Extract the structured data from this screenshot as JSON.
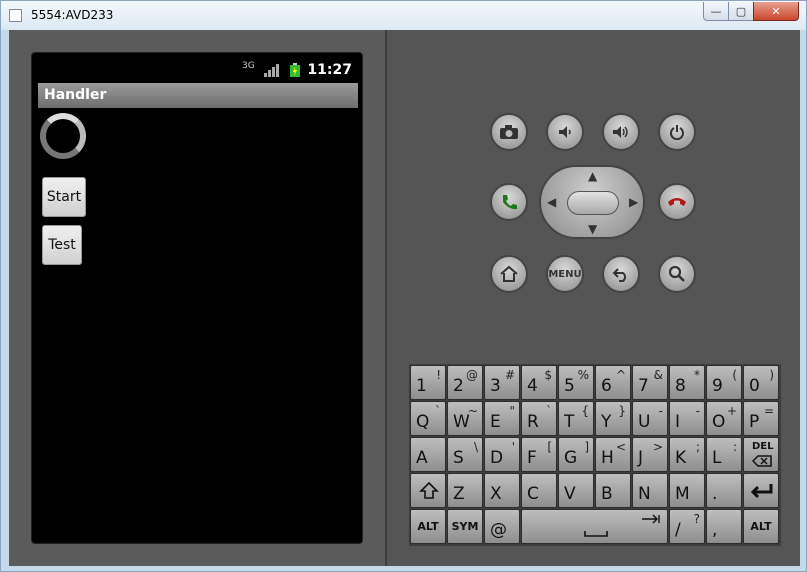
{
  "window": {
    "title": "5554:AVD233",
    "min_label": "—",
    "max_label": "▢",
    "close_label": "✕"
  },
  "status_bar": {
    "time": "11:27",
    "network_label": "3G"
  },
  "app": {
    "title": "Handler",
    "start_button": "Start",
    "test_button": "Test"
  },
  "controls": {
    "menu_label": "MENU"
  },
  "keyboard": {
    "row1": [
      {
        "main": "1",
        "sub": "!"
      },
      {
        "main": "2",
        "sub": "@"
      },
      {
        "main": "3",
        "sub": "#"
      },
      {
        "main": "4",
        "sub": "$"
      },
      {
        "main": "5",
        "sub": "%"
      },
      {
        "main": "6",
        "sub": "^"
      },
      {
        "main": "7",
        "sub": "&"
      },
      {
        "main": "8",
        "sub": "*"
      },
      {
        "main": "9",
        "sub": "("
      },
      {
        "main": "0",
        "sub": ")"
      }
    ],
    "row2": [
      {
        "main": "Q",
        "sub": "`"
      },
      {
        "main": "W",
        "sub": "~"
      },
      {
        "main": "E",
        "sub": "\""
      },
      {
        "main": "R",
        "sub": "`"
      },
      {
        "main": "T",
        "sub": "{"
      },
      {
        "main": "Y",
        "sub": "}"
      },
      {
        "main": "U",
        "sub": "-"
      },
      {
        "main": "I",
        "sub": "-"
      },
      {
        "main": "O",
        "sub": "+"
      },
      {
        "main": "P",
        "sub": "="
      }
    ],
    "row3": [
      {
        "main": "A",
        "sub": ""
      },
      {
        "main": "S",
        "sub": "\\"
      },
      {
        "main": "D",
        "sub": "'"
      },
      {
        "main": "F",
        "sub": "["
      },
      {
        "main": "G",
        "sub": "]"
      },
      {
        "main": "H",
        "sub": "<"
      },
      {
        "main": "J",
        "sub": ">"
      },
      {
        "main": "K",
        "sub": ";"
      },
      {
        "main": "L",
        "sub": ":"
      }
    ],
    "del_label": "DEL",
    "row4": [
      {
        "main": "Z"
      },
      {
        "main": "X"
      },
      {
        "main": "C"
      },
      {
        "main": "V"
      },
      {
        "main": "B"
      },
      {
        "main": "N"
      },
      {
        "main": "M"
      },
      {
        "main": "."
      }
    ],
    "alt_label": "ALT",
    "sym_label": "SYM",
    "at_label": "@",
    "slash_main": "/",
    "slash_sub": "?",
    "comma_label": ","
  }
}
